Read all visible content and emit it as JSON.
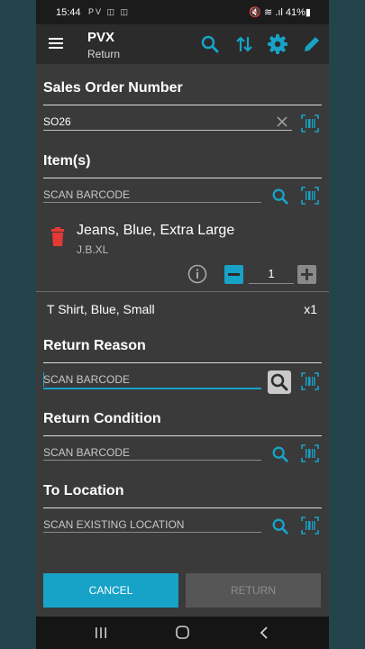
{
  "status_bar": {
    "time": "15:44",
    "notification_icons": "PV ◫ ◫",
    "right_status": "🔇 ≋ .ıl 41%▮"
  },
  "app_bar": {
    "title": "PVX",
    "subtitle": "Return",
    "icons": [
      "menu-icon",
      "search-icon",
      "sort-icon",
      "gear-icon",
      "edit-icon"
    ]
  },
  "sales_order": {
    "label": "Sales Order Number",
    "value": "SO26"
  },
  "items": {
    "label": "Item(s)",
    "placeholder": "SCAN BARCODE",
    "card": {
      "name": "Jeans, Blue, Extra Large",
      "sku": "J.B.XL",
      "quantity": "1"
    },
    "summary": [
      {
        "name": "T Shirt, Blue, Small",
        "qty": "x1"
      }
    ]
  },
  "return_reason": {
    "label": "Return Reason",
    "placeholder": "SCAN BARCODE"
  },
  "return_condition": {
    "label": "Return Condition",
    "placeholder": "SCAN BARCODE"
  },
  "to_location": {
    "label": "To Location",
    "placeholder": "SCAN EXISTING LOCATION"
  },
  "buttons": {
    "cancel": "CANCEL",
    "return": "RETURN"
  },
  "colors": {
    "accent": "#17a3c8",
    "delete": "#e53935",
    "background": "#3a3a3a",
    "app_bar": "#2b2b2b"
  }
}
